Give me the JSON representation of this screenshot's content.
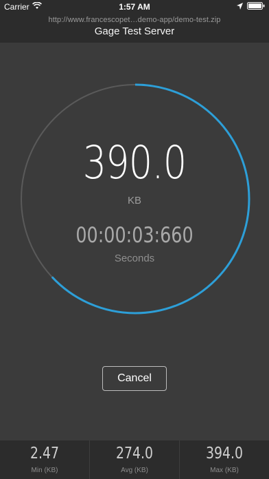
{
  "status_bar": {
    "carrier": "Carrier",
    "time": "1:57 AM",
    "icons": [
      "wifi-icon",
      "location-arrow-icon",
      "battery-icon"
    ]
  },
  "header": {
    "url": "http://www.francescopet…demo-app/demo-test.zip",
    "title": "Gage Test Server"
  },
  "gauge": {
    "progress_fraction": 0.63,
    "track_color": "#5a5a5a",
    "progress_color": "#2d9fd8"
  },
  "reading": {
    "value": "390.0",
    "unit": "KB",
    "elapsed": "00:00:03:660",
    "elapsed_unit": "Seconds"
  },
  "actions": {
    "cancel_label": "Cancel"
  },
  "stats": [
    {
      "value": "2.47",
      "label": "Min (KB)"
    },
    {
      "value": "274.0",
      "label": "Avg (KB)"
    },
    {
      "value": "394.0",
      "label": "Max (KB)"
    }
  ]
}
